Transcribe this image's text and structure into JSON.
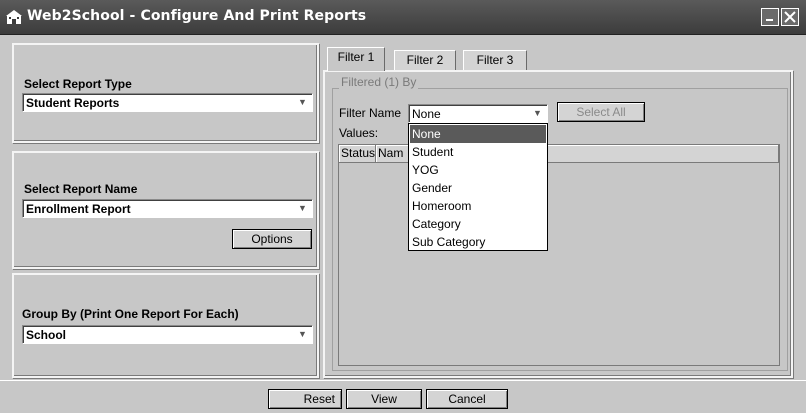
{
  "window": {
    "title": "Web2School - Configure And Print Reports"
  },
  "left": {
    "report_type": {
      "label": "Select Report Type",
      "value": "Student Reports"
    },
    "report_name": {
      "label": "Select Report Name",
      "value": "Enrollment Report",
      "options_button": "Options"
    },
    "group_by": {
      "label": "Group By  (Print One Report For Each)",
      "value": "School"
    }
  },
  "tabs": [
    {
      "label": "Filter 1"
    },
    {
      "label": "Filter 2"
    },
    {
      "label": "Filter 3"
    }
  ],
  "filter": {
    "group_title": "Filtered (1) By",
    "filter_name_label": "Filter Name",
    "filter_name_value": "None",
    "select_all": "Select All",
    "values_label": "Values:",
    "columns": [
      "Status",
      "Nam"
    ],
    "dropdown_options": [
      "None",
      "Student",
      "YOG",
      "Gender",
      "Homeroom",
      "Category",
      "Sub Category"
    ]
  },
  "footer": {
    "reset": "Reset",
    "view": "View",
    "cancel": "Cancel"
  }
}
